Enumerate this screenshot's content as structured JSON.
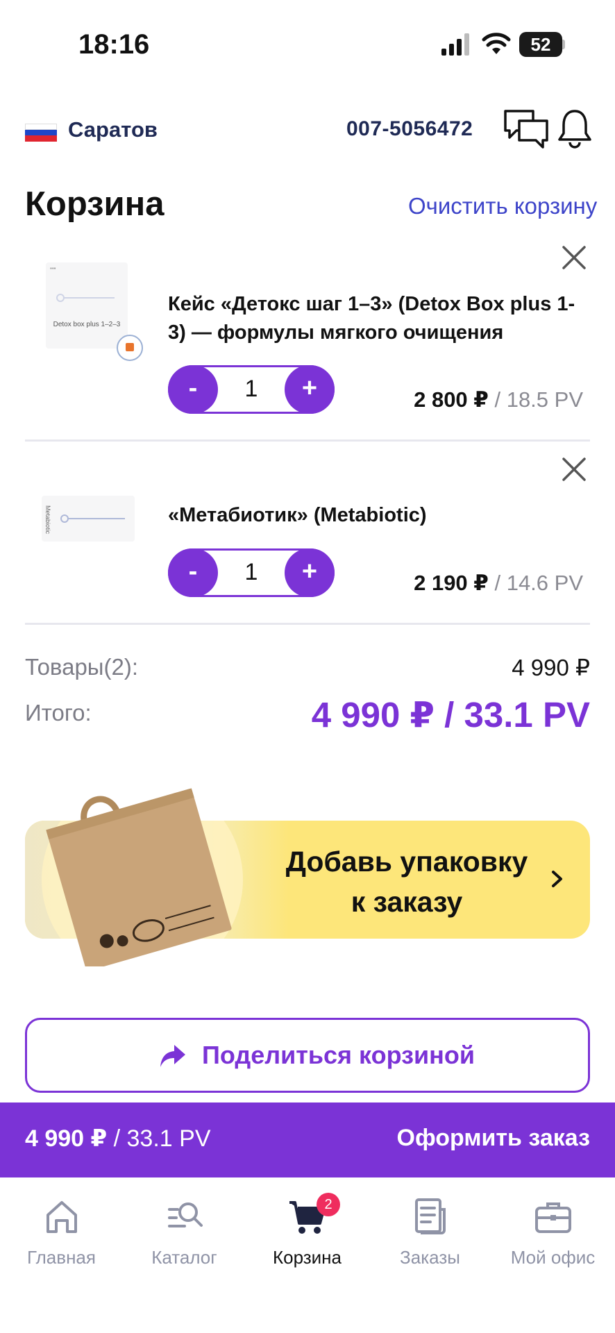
{
  "status_bar": {
    "time": "18:16",
    "battery": "52"
  },
  "header": {
    "city": "Саратов",
    "phone": "007-5056472",
    "icons": [
      "flag-russia-icon",
      "chat-icon",
      "bell-icon"
    ]
  },
  "cart": {
    "title": "Корзина",
    "clear_label": "Очистить корзину",
    "items": [
      {
        "name": "Кейс «Детокс шаг 1–3» (Detox Box plus 1-3) — формулы мягкого очищения",
        "image_text": "Detox box plus 1–2–3",
        "quantity": "1",
        "price": "2 800 ₽",
        "pv": " / 18.5 PV",
        "minus": "-",
        "plus": "+"
      },
      {
        "name": "«Метабиотик» (Metabiotic)",
        "image_text": "Metabiotic",
        "quantity": "1",
        "price": "2 190 ₽",
        "pv": " / 14.6 PV",
        "minus": "-",
        "plus": "+"
      }
    ]
  },
  "summary": {
    "goods_label": "Товары(2):",
    "goods_value": "4 990 ₽",
    "total_label": "Итого:",
    "total_value": "4 990 ₽ / 33.1 PV"
  },
  "promo": {
    "line1": "Добавь упаковку",
    "line2": "к заказу"
  },
  "share": {
    "label": "Поделиться корзиной"
  },
  "checkout": {
    "price": "4 990 ₽",
    "pv": " / 33.1 PV",
    "button": "Оформить заказ"
  },
  "nav": {
    "items": [
      {
        "label": "Главная",
        "icon": "home-icon"
      },
      {
        "label": "Каталог",
        "icon": "catalog-search-icon"
      },
      {
        "label": "Корзина",
        "icon": "cart-icon",
        "badge": "2",
        "active": true
      },
      {
        "label": "Заказы",
        "icon": "orders-icon"
      },
      {
        "label": "Мой офис",
        "icon": "briefcase-icon"
      }
    ]
  },
  "colors": {
    "accent": "#7b33d6",
    "link": "#3d44c9",
    "promo": "#fde67a",
    "badge": "#ef2d5e"
  }
}
